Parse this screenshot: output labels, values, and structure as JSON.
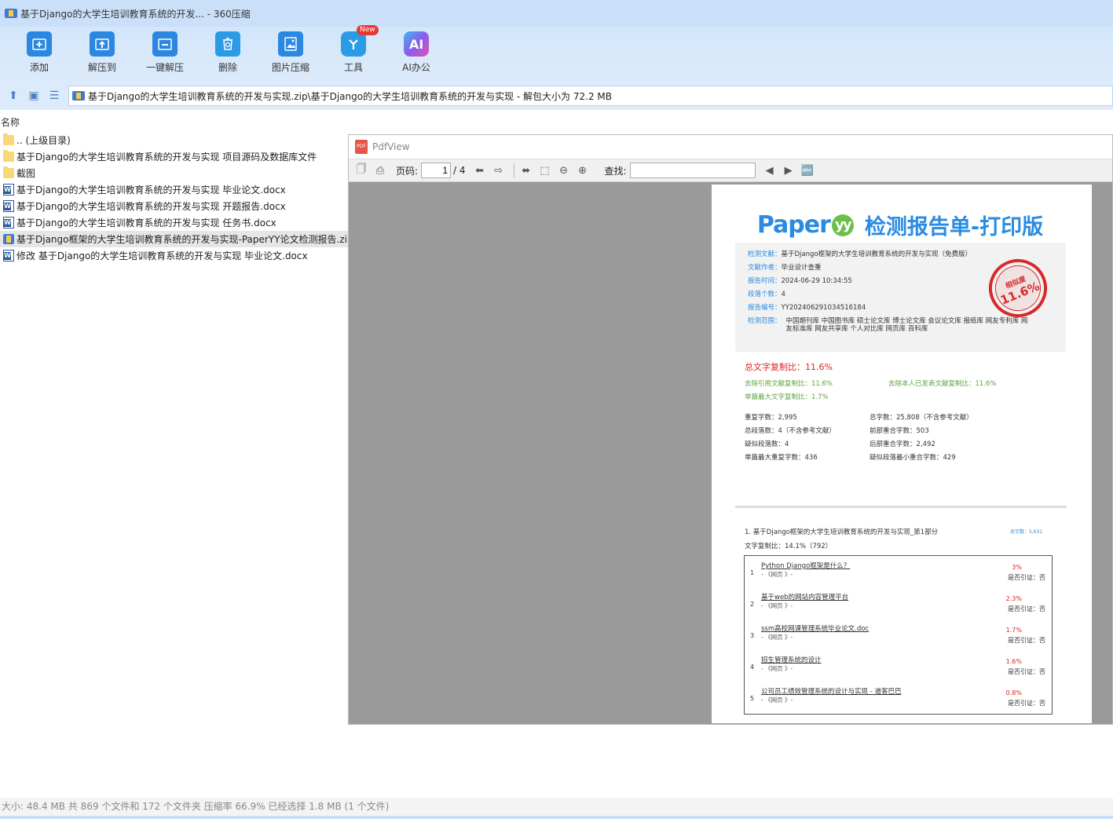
{
  "window": {
    "title": "基于Django的大学生培训教育系统的开发... - 360压缩"
  },
  "toolbar": {
    "items": [
      {
        "label": "添加",
        "icon": "add-icon",
        "color": "#2b87df"
      },
      {
        "label": "解压到",
        "icon": "extract-to-icon",
        "color": "#2b87df"
      },
      {
        "label": "一键解压",
        "icon": "one-click-extract-icon",
        "color": "#2b87df"
      },
      {
        "label": "删除",
        "icon": "recycle-delete-icon",
        "color": "#2b9be6"
      },
      {
        "label": "图片压缩",
        "icon": "image-compress-icon",
        "color": "#2b87df"
      },
      {
        "label": "工具",
        "icon": "tools-icon",
        "color": "#2b9be6",
        "badge": "New"
      },
      {
        "label": "AI办公",
        "icon": "ai-office-icon",
        "color": "#8a5cf0",
        "glyph": "AI"
      }
    ]
  },
  "address": {
    "path": "基于Django的大学生培训教育系统的开发与实现.zip\\基于Django的大学生培训教育系统的开发与实现 - 解包大小为 72.2 MB"
  },
  "filelist": {
    "column_name": "名称",
    "rows": [
      {
        "name": ".. (上级目录)",
        "type": "folder"
      },
      {
        "name": "基于Django的大学生培训教育系统的开发与实现 项目源码及数据库文件",
        "type": "folder"
      },
      {
        "name": "截图",
        "type": "folder"
      },
      {
        "name": "基于Django的大学生培训教育系统的开发与实现 毕业论文.docx",
        "type": "docx"
      },
      {
        "name": "基于Django的大学生培训教育系统的开发与实现 开题报告.docx",
        "type": "docx"
      },
      {
        "name": "基于Django的大学生培训教育系统的开发与实现 任务书.docx",
        "type": "docx"
      },
      {
        "name": "基于Django框架的大学生培训教育系统的开发与实现-PaperYY论文检测报告.zip",
        "type": "zip",
        "selected": true
      },
      {
        "name": "修改 基于Django的大学生培训教育系统的开发与实现 毕业论文.docx",
        "type": "docx"
      }
    ]
  },
  "pdfview": {
    "title": "PdfView",
    "page_label": "页码:",
    "page_current": "1",
    "page_total": "/ 4",
    "search_label": "查找:"
  },
  "report": {
    "logo": "Paper",
    "logo_yy": "yy",
    "title": "检测报告单-打印版",
    "info": [
      {
        "key": "检测文献：",
        "value": "基于Django框架的大学生培训教育系统的开发与实现（免费版）"
      },
      {
        "key": "文献作者：",
        "value": "毕业设计查重"
      },
      {
        "key": "报告时间：",
        "value": "2024-06-29 10:34:55"
      },
      {
        "key": "段落个数：",
        "value": "4"
      },
      {
        "key": "报告编号：",
        "value": "YY202406291034516184"
      },
      {
        "key": "检测范围：",
        "value": "中国期刊库  中国图书库  硕士论文库  博士论文库  会议论文库  报纸库  网友专利库  网友标准库  网友共享库  个人对比库  网页库  百科库"
      }
    ],
    "stamp_label": "相似度",
    "stamp_value": "11.6%",
    "total_ratio": "总文字复制比：11.6%",
    "exclude_ref": "去除引用文献复制比：11.6%",
    "exclude_self": "去除本人已发表文献复制比：11.6%",
    "max_single": "单篇最大文字复制比：1.7%",
    "stats_left": [
      "重复字数：2,995",
      "总段落数：4（不含参考文献）",
      "疑似段落数：4",
      "单篇最大重复字数：436"
    ],
    "stats_right": [
      "总字数：25,808（不含参考文献）",
      "前部重合字数：503",
      "后部重合字数：2,492",
      "疑似段落最小重合字数：429"
    ],
    "part_title": "1. 基于Django框架的大学生培训教育系统的开发与实现_第1部分",
    "part_count": "总字数：5,631",
    "part_ratio": "文字复制比：14.1%（792）",
    "sources": [
      {
        "num": "1",
        "title": "Python Django框架是什么？",
        "site": "- 《网页 》-",
        "pct": "3%",
        "cite": "是否引证：否"
      },
      {
        "num": "2",
        "title": "基于web的网站内容管理平台",
        "site": "- 《网页 》-",
        "pct": "2.3%",
        "cite": "是否引证：否"
      },
      {
        "num": "3",
        "title": "ssm高校网课管理系统毕业论文.doc",
        "site": "- 《网页 》-",
        "pct": "1.7%",
        "cite": "是否引证：否"
      },
      {
        "num": "4",
        "title": "招生管理系统的设计",
        "site": "- 《网页 》-",
        "pct": "1.6%",
        "cite": "是否引证：否"
      },
      {
        "num": "5",
        "title": "公司员工绩效管理系统的设计与实现 - 道客巴巴",
        "site": "- 《网页 》-",
        "pct": "0.8%",
        "cite": "是否引证：否"
      }
    ]
  },
  "statusbar": {
    "text": "大小: 48.4 MB 共 869 个文件和 172 个文件夹 压缩率 66.9% 已经选择 1.8 MB (1 个文件)"
  }
}
